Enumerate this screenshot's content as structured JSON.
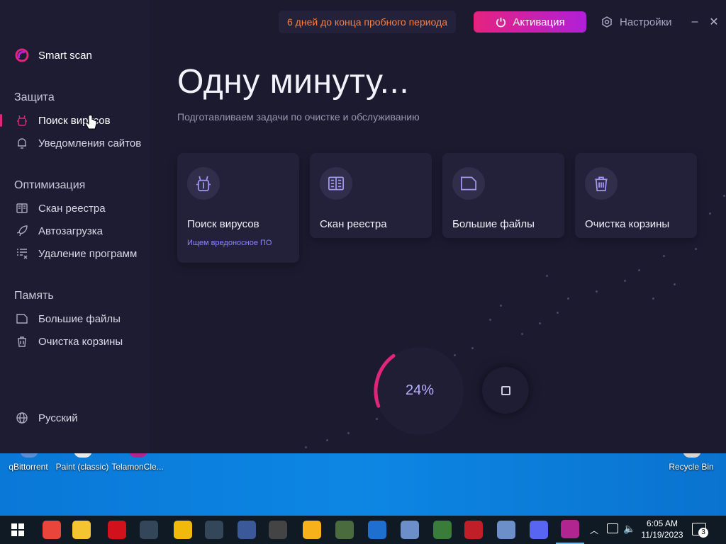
{
  "app": {
    "trial_text": "6 дней до конца пробного периода",
    "activate_label": "Активация",
    "settings_label": "Настройки",
    "minimize_glyph": "–",
    "close_glyph": "✕"
  },
  "sidebar": {
    "smart_scan": "Smart scan",
    "sections": [
      {
        "title": "Защита",
        "items": [
          {
            "label": "Поиск вирусов",
            "icon": "bug-icon",
            "active": true
          },
          {
            "label": "Уведомления сайтов",
            "icon": "bell-icon"
          }
        ]
      },
      {
        "title": "Оптимизация",
        "items": [
          {
            "label": "Скан реестра",
            "icon": "book-icon"
          },
          {
            "label": "Автозагрузка",
            "icon": "rocket-icon"
          },
          {
            "label": "Удаление программ",
            "icon": "list-remove-icon"
          }
        ]
      },
      {
        "title": "Память",
        "items": [
          {
            "label": "Большие файлы",
            "icon": "folder-icon"
          },
          {
            "label": "Очистка корзины",
            "icon": "trash-icon"
          }
        ]
      }
    ],
    "language": "Русский"
  },
  "main": {
    "headline": "Одну минуту...",
    "subtitle": "Подготавливаем задачи по очистке и обслуживанию",
    "cards": [
      {
        "title": "Поиск вирусов",
        "status": "Ищем вредоносное ПО",
        "icon": "bug-icon"
      },
      {
        "title": "Скан реестра",
        "icon": "book-icon"
      },
      {
        "title": "Большие файлы",
        "icon": "folder-icon"
      },
      {
        "title": "Очистка корзины",
        "icon": "trash-icon"
      }
    ],
    "progress_percent": 24,
    "progress_label": "24%"
  },
  "desktop_icons": [
    {
      "label": "qBittorrent",
      "color": "#5a8fd4"
    },
    {
      "label": "Paint (classic)",
      "color": "#e8e8e8"
    },
    {
      "label": "TelamonCle...",
      "color": "#b0258f"
    },
    {
      "label": "Recycle Bin",
      "color": "#d5d5d5"
    }
  ],
  "taskbar": {
    "apps": [
      {
        "name": "start-button",
        "color": "#ffffff"
      },
      {
        "name": "chrome-app",
        "color": "#e9453b"
      },
      {
        "name": "file-explorer-app",
        "color": "#f5c531"
      },
      {
        "name": "opera-app",
        "color": "#d1121d"
      },
      {
        "name": "world-of-warships-app",
        "color": "#33465a"
      },
      {
        "name": "binance-app",
        "color": "#f0b90b"
      },
      {
        "name": "world-of-warships-app-2",
        "color": "#33465a"
      },
      {
        "name": "facebook-app",
        "color": "#3b5998"
      },
      {
        "name": "world-of-tanks-app",
        "color": "#444444"
      },
      {
        "name": "opera-gx-app",
        "color": "#f7b21b"
      },
      {
        "name": "paint-app",
        "color": "#4a6b3e"
      },
      {
        "name": "media-player-app",
        "color": "#1f6fd0"
      },
      {
        "name": "control-panel-app",
        "color": "#6c8fc9"
      },
      {
        "name": "sandbox-app",
        "color": "#3a7c3a"
      },
      {
        "name": "red-app",
        "color": "#c11f28"
      },
      {
        "name": "control-panel-app-2",
        "color": "#6c8fc9"
      },
      {
        "name": "discord-app",
        "color": "#5865f2"
      },
      {
        "name": "telamon-cleaner-app",
        "color": "#b0258f"
      }
    ],
    "time": "6:05 AM",
    "date": "11/19/2023",
    "notification_count": "3"
  }
}
